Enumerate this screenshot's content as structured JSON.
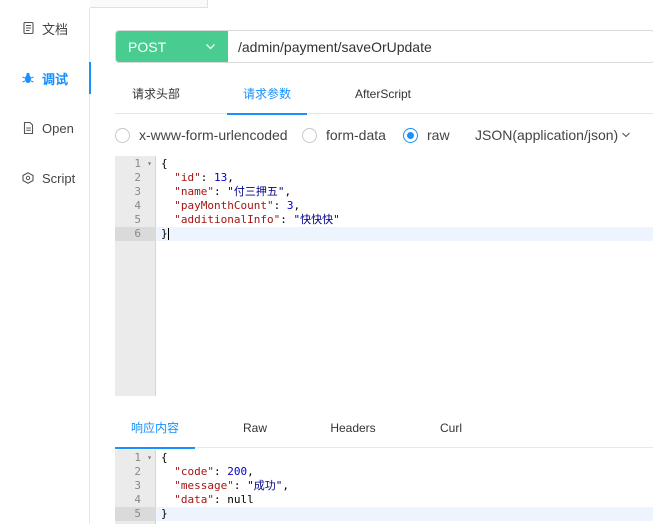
{
  "sidebar": {
    "items": [
      {
        "label": "文档",
        "icon": "document-icon"
      },
      {
        "label": "调试",
        "icon": "bug-icon",
        "active": true
      },
      {
        "label": "Open",
        "icon": "file-icon"
      },
      {
        "label": "Script",
        "icon": "plugin-icon"
      }
    ]
  },
  "request": {
    "method": "POST",
    "url": "/admin/payment/saveOrUpdate"
  },
  "tabs": [
    {
      "label": "请求头部"
    },
    {
      "label": "请求参数",
      "active": true
    },
    {
      "label": "AfterScript"
    }
  ],
  "body_types": [
    {
      "label": "x-www-form-urlencoded",
      "checked": false
    },
    {
      "label": "form-data",
      "checked": false
    },
    {
      "label": "raw",
      "checked": true
    }
  ],
  "content_type": "JSON(application/json)",
  "request_body": {
    "line_numbers": [
      "1",
      "2",
      "3",
      "4",
      "5",
      "6"
    ],
    "lines": [
      {
        "open": "{"
      },
      {
        "key": "\"id\"",
        "sep": ": ",
        "val": "13",
        "end": ","
      },
      {
        "key": "\"name\"",
        "sep": ": ",
        "val": "\"付三押五\"",
        "end": ","
      },
      {
        "key": "\"payMonthCount\"",
        "sep": ": ",
        "val": "3",
        "end": ","
      },
      {
        "key": "\"additionalInfo\"",
        "sep": ": ",
        "val": "\"快快快\"",
        "end": ""
      },
      {
        "open": "}"
      }
    ]
  },
  "response_tabs": [
    {
      "label": "响应内容",
      "active": true
    },
    {
      "label": "Raw"
    },
    {
      "label": "Headers"
    },
    {
      "label": "Curl"
    }
  ],
  "response_body": {
    "line_numbers": [
      "1",
      "2",
      "3",
      "4",
      "5"
    ],
    "lines": [
      {
        "open": "{"
      },
      {
        "key": "\"code\"",
        "sep": ": ",
        "val": "200",
        "end": ","
      },
      {
        "key": "\"message\"",
        "sep": ": ",
        "val": "\"成功\"",
        "end": ","
      },
      {
        "key": "\"data\"",
        "sep": ": ",
        "val": "null",
        "end": ""
      },
      {
        "open": "}"
      }
    ]
  },
  "colors": {
    "accent": "#1890ff",
    "method_bg": "#49cc90"
  }
}
